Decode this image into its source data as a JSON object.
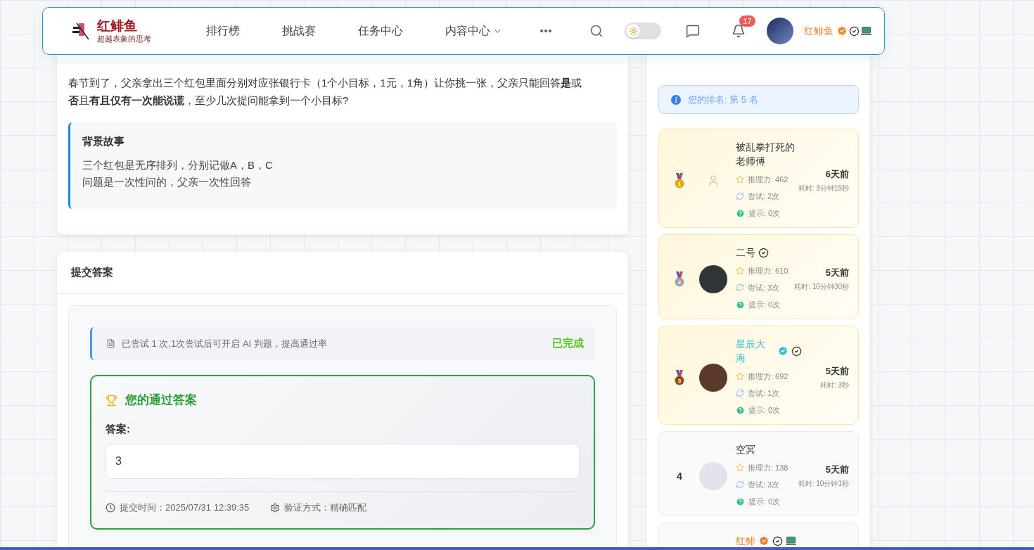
{
  "header": {
    "brand": {
      "title": "红鲱鱼",
      "slogan": "超越表象的思考"
    },
    "nav": [
      {
        "label": "排行榜",
        "has_menu": false
      },
      {
        "label": "挑战赛",
        "has_menu": false
      },
      {
        "label": "任务中心",
        "has_menu": false
      },
      {
        "label": "内容中心",
        "has_menu": true
      }
    ],
    "dark_mode": false,
    "notification_count": "17",
    "user": {
      "name": "红鲱鱼",
      "badges": [
        {
          "kind": "verified"
        },
        {
          "kind": "check"
        },
        {
          "kind": "device"
        }
      ]
    }
  },
  "problem": {
    "text": "春节到了，父亲拿出三个红包里面分别对应张银行卡（1个小目标，1元，1角）让你挑一张，父亲只能回答**是**或**否**且**有且仅有一次能说谎**，至少几次提问能拿到一个小目标?",
    "background_story": {
      "title": "背景故事",
      "lines": [
        "三个红包是无序排列，分别记做A，B，C",
        "问题是一次性问的，父亲一次性回答"
      ]
    }
  },
  "submit_answer": {
    "title": "提交答案",
    "notice": "已尝试 1 次,1次尝试后可开启 AI 判题，提高通过率",
    "status": "已完成",
    "passed_answer": {
      "title": "您的通过答案",
      "label": "答案:",
      "value": "3",
      "submitted_at": "提交时间：2025/07/31 12:39:35",
      "verification": "验证方式：精确匹配"
    }
  },
  "ranking": {
    "my_rank": "您的排名: 第 5 名",
    "entries": [
      {
        "kind": "gold",
        "rank": "1",
        "custom_avatar": false,
        "name": "被乱拳打死的老师傅",
        "color": "#333333",
        "power": "推理力: 462",
        "attempts": "尝试: 2次",
        "hints": "提示: 0次",
        "ago": "6天前",
        "duration": "耗时: 3分钟15秒"
      },
      {
        "kind": "silver",
        "rank": "2",
        "custom_avatar": true,
        "name": "二号",
        "color": "#333333",
        "badges": [
          {
            "kind": "check"
          }
        ],
        "power": "推理力: 610",
        "attempts": "尝试: 3次",
        "hints": "提示: 0次",
        "ago": "5天前",
        "duration": "耗时: 10分钟30秒"
      },
      {
        "kind": "bronze",
        "rank": "3",
        "custom_avatar": true,
        "name": "星辰大海",
        "color": "#3bbfd0",
        "badges": [
          {
            "kind": "verified"
          },
          {
            "kind": "check"
          }
        ],
        "power": "推理力: 692",
        "attempts": "尝试: 1次",
        "hints": "提示: 0次",
        "ago": "5天前",
        "duration": "耗时: 3秒"
      },
      {
        "kind": "plain",
        "rank": "4",
        "custom_avatar": true,
        "name": "空冥",
        "color": "#333333",
        "power": "推理力: 138",
        "attempts": "尝试: 3次",
        "hints": "提示: 0次",
        "ago": "5天前",
        "duration": "耗时: 10分钟1秒"
      },
      {
        "kind": "plain",
        "name": "红鲱",
        "color": "#f07c22",
        "badges": [
          {
            "kind": "verified"
          },
          {
            "kind": "check"
          },
          {
            "kind": "device"
          }
        ]
      }
    ]
  }
}
